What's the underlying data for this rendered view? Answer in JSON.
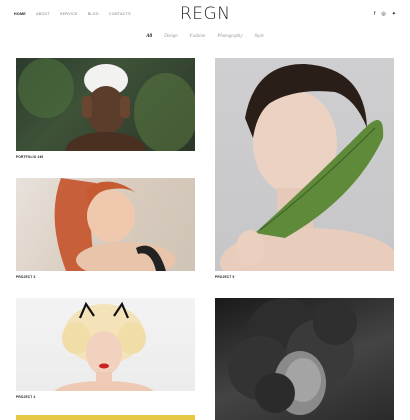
{
  "header": {
    "nav": [
      {
        "label": "Home",
        "active": true
      },
      {
        "label": "About",
        "active": false
      },
      {
        "label": "Service",
        "active": false
      },
      {
        "label": "Blog",
        "active": false
      },
      {
        "label": "Contacts",
        "active": false
      }
    ],
    "logo": "REGN",
    "social": [
      {
        "icon": "facebook-icon",
        "glyph": "f"
      },
      {
        "icon": "instagram-icon",
        "glyph": "◎"
      },
      {
        "icon": "twitter-icon",
        "glyph": "✦"
      }
    ]
  },
  "filters": [
    {
      "label": "All",
      "active": true
    },
    {
      "label": "Design",
      "active": false
    },
    {
      "label": "Fashion",
      "active": false
    },
    {
      "label": "Photography",
      "active": false
    },
    {
      "label": "Style",
      "active": false
    }
  ],
  "portfolio": [
    {
      "caption": "Portfolio 249"
    },
    {
      "caption": "Project 3"
    },
    {
      "caption": "Project 5"
    },
    {
      "caption": "Project 4"
    }
  ],
  "colors": {
    "accent_tile": "#e7c843",
    "text": "#111111",
    "muted": "#999999"
  }
}
